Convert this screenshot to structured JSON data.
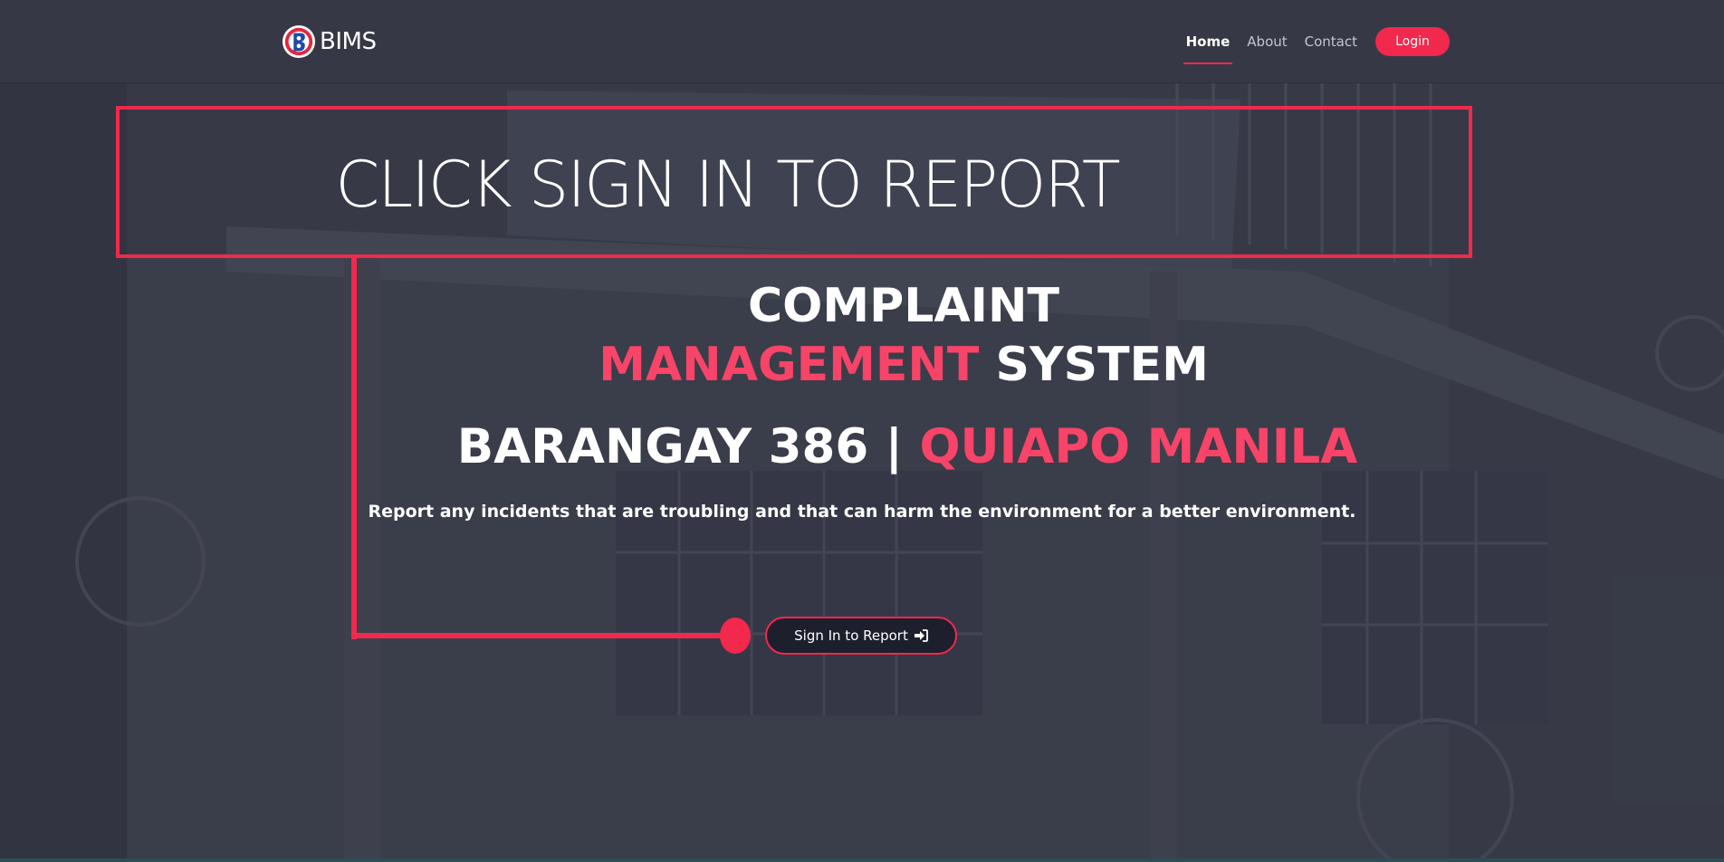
{
  "brand": {
    "name": "BIMS",
    "logo_icon": "barangay-seal-icon"
  },
  "nav": {
    "items": [
      {
        "label": "Home",
        "active": true
      },
      {
        "label": "About",
        "active": false
      },
      {
        "label": "Contact",
        "active": false
      }
    ],
    "login_label": "Login"
  },
  "hero": {
    "callout": "CLICK SIGN IN TO REPORT",
    "title_line1": "COMPLAINT",
    "title_line2_accent": "MANAGEMENT",
    "title_line2_rest": "SYSTEM",
    "subtitle_main": "BARANGAY 386 |",
    "subtitle_accent": "QUIAPO MANILA",
    "description": "Report any incidents that are troubling and that can harm the environment for a better environment.",
    "signin_label": "Sign In to Report",
    "signin_icon": "sign-in-icon"
  },
  "colors": {
    "accent": "#f2284d",
    "accent_text": "#f84468",
    "navbar": "#363945",
    "button_dark": "#1d1f2d"
  }
}
